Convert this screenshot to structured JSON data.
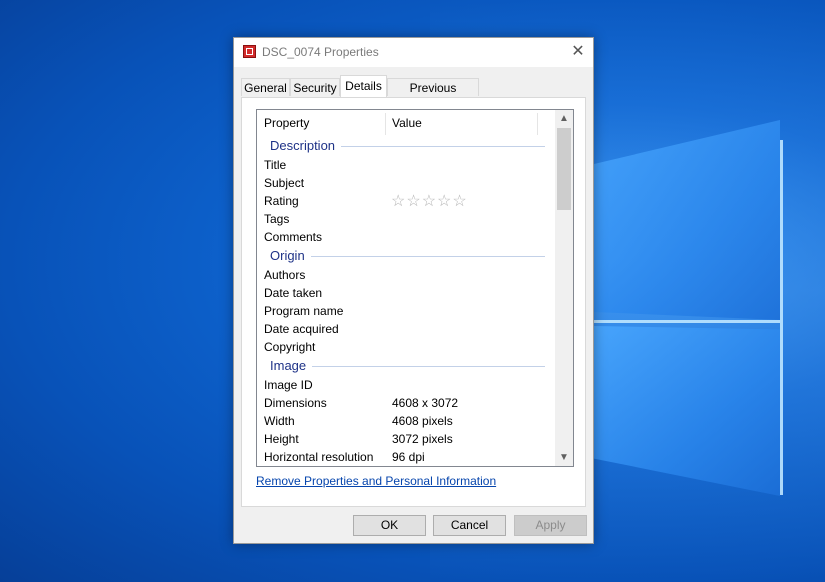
{
  "window": {
    "title": "DSC_0074 Properties",
    "close_glyph": "✕"
  },
  "tabs": [
    {
      "label": "General"
    },
    {
      "label": "Security"
    },
    {
      "label": "Details",
      "active": true
    },
    {
      "label": "Previous Versions"
    }
  ],
  "details": {
    "header_property": "Property",
    "header_value": "Value",
    "groups": {
      "description": {
        "label": "Description",
        "rows": {
          "title": {
            "key": "Title",
            "value": ""
          },
          "subject": {
            "key": "Subject",
            "value": ""
          },
          "rating": {
            "key": "Rating",
            "value": "☆☆☆☆☆"
          },
          "tags": {
            "key": "Tags",
            "value": ""
          },
          "comments": {
            "key": "Comments",
            "value": ""
          }
        }
      },
      "origin": {
        "label": "Origin",
        "rows": {
          "authors": {
            "key": "Authors",
            "value": ""
          },
          "date_taken": {
            "key": "Date taken",
            "value": ""
          },
          "program_name": {
            "key": "Program name",
            "value": ""
          },
          "date_acquired": {
            "key": "Date acquired",
            "value": ""
          },
          "copyright": {
            "key": "Copyright",
            "value": ""
          }
        }
      },
      "image": {
        "label": "Image",
        "rows": {
          "image_id": {
            "key": "Image ID",
            "value": ""
          },
          "dimensions": {
            "key": "Dimensions",
            "value": "4608 x 3072"
          },
          "width": {
            "key": "Width",
            "value": "4608 pixels"
          },
          "height": {
            "key": "Height",
            "value": "3072 pixels"
          },
          "horizontal_resolution": {
            "key": "Horizontal resolution",
            "value": "96 dpi"
          }
        }
      }
    },
    "scroll_up_glyph": "▲",
    "scroll_down_glyph": "▼"
  },
  "remove_link": "Remove Properties and Personal Information",
  "buttons": {
    "ok": "OK",
    "cancel": "Cancel",
    "apply": "Apply"
  },
  "colors": {
    "group_header": "#1e3287",
    "link": "#0645ad",
    "desktop": "#0a5fc4"
  }
}
